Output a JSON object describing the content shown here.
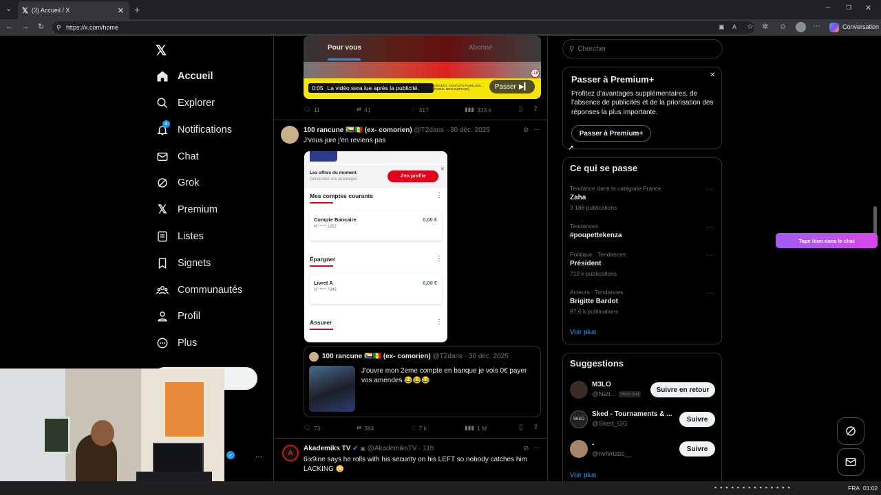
{
  "browser": {
    "tab_title": "(3) Accueil / X",
    "url": "https://x.com/home",
    "conversation_label": "Conversation"
  },
  "nav": {
    "items": [
      {
        "label": "Accueil"
      },
      {
        "label": "Explorer"
      },
      {
        "label": "Notifications",
        "badge": "3"
      },
      {
        "label": "Chat"
      },
      {
        "label": "Grok"
      },
      {
        "label": "Premium"
      },
      {
        "label": "Listes"
      },
      {
        "label": "Signets"
      },
      {
        "label": "Communautés"
      },
      {
        "label": "Profil"
      },
      {
        "label": "Plus"
      }
    ]
  },
  "feed": {
    "tabs": [
      "Pour vous",
      "Abonné"
    ],
    "ad": {
      "time": "0:05",
      "notice": "La vidéo sera lue après la publicité.",
      "skip": "Passer",
      "small_text": "ARGENT, CONFLITS FAMILIAUX, ... PARLE, NON SURTAXÉ)",
      "rating": "-18",
      "stats": {
        "replies": "11",
        "reposts": "41",
        "likes": "317",
        "views": "333 k"
      }
    },
    "post1": {
      "name": "100 rancune 🇰🇲🇸🇳 (ex- comorien)",
      "handle": "@T2dans",
      "date": "30 déc. 2025",
      "text": "J'vous jure j'en reviens pas",
      "bank": {
        "offers_title": "Les offres du moment",
        "offers_sub": "Découvrez vos avantages",
        "offers_btn": "J'en profite",
        "section1": "Mes comptes courants",
        "acc1_name": "Compte Bancaire",
        "acc1_num": "N° **** 1362",
        "acc1_val": "0,00 €",
        "section2": "Épargner",
        "acc2_name": "Livret A",
        "acc2_num": "N° **** 7943",
        "acc2_val": "0,00 €",
        "section3": "Assurer"
      },
      "quote": {
        "name": "100 rancune 🇰🇲🇸🇳 (ex- comorien)",
        "handle": "@T2dans",
        "date": "30 déc. 2025",
        "text": "J'ouvre mon 2eme compte en banque je vois 0€ payer vos amendes 😂😂😂"
      },
      "stats": {
        "replies": "73",
        "reposts": "384",
        "likes": "7 k",
        "views": "1 M"
      }
    },
    "post2": {
      "name": "Akademiks TV",
      "handle": "@AkademiksTV",
      "date": "11h",
      "text": "6ix9ine says he rolls with his security on his LEFT so nobody catches him LACKING 😳"
    }
  },
  "search": {
    "placeholder": "Chercher"
  },
  "premium": {
    "title": "Passer à Premium+",
    "text": "Profitez d'avantages supplémentaires, de l'absence de publicités et de la priorisation des réponses la plus importante.",
    "button": "Passer à Premium+"
  },
  "trends": {
    "title": "Ce qui se passe",
    "items": [
      {
        "meta": "Tendance dans la catégorie France",
        "name": "Zaha",
        "count": "3 188 publications"
      },
      {
        "meta": "Tendances",
        "name": "#poupettekenza",
        "count": ""
      },
      {
        "meta": "Politique · Tendances",
        "name": "Président",
        "count": "719 k publications"
      },
      {
        "meta": "Acteurs · Tendances",
        "name": "Brigitte Bardot",
        "count": "87,6 k publications"
      }
    ],
    "more": "Voir plus"
  },
  "suggestions": {
    "title": "Suggestions",
    "items": [
      {
        "name": "M3LO",
        "handle": "@Nati...",
        "tag": "Vous suit",
        "button": "Suivre en retour"
      },
      {
        "name": "Sked - Tournaments & ...",
        "handle": "@Sked_GG",
        "tag": "",
        "button": "Suivre"
      },
      {
        "name": "-",
        "handle": "@nvfvriass__",
        "tag": "",
        "button": "Suivre"
      }
    ],
    "more": "Voir plus"
  },
  "stream_overlay": {
    "text": "Tape !don dans le chat"
  },
  "taskbar": {
    "lang": "FRA",
    "time": "01:02"
  },
  "colors": {
    "accent": "#1d9bf0",
    "background": "#000000",
    "border": "#2f3336",
    "muted": "#71767b",
    "ad_yellow": "#f5e50a",
    "bank_red": "#e2001a",
    "bank_green": "#1e8a3c"
  }
}
